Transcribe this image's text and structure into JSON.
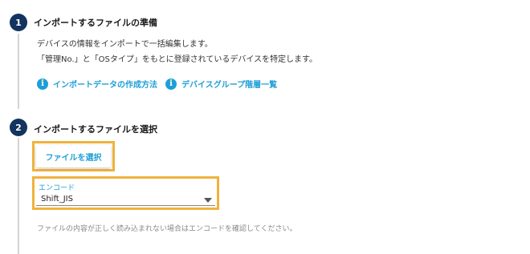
{
  "step1": {
    "number": "1",
    "title": "インポートするファイルの準備",
    "desc_line1": "デバイスの情報をインポートで一括編集します。",
    "desc_line2": "「管理No.」と「OSタイプ」をもとに登録されているデバイスを特定します。",
    "link1_label": "インポートデータの作成方法",
    "link2_label": "デバイスグループ階層一覧",
    "info_glyph": "i"
  },
  "step2": {
    "number": "2",
    "title": "インポートするファイルを選択",
    "file_button_label": "ファイルを選択",
    "encode_label": "エンコード",
    "encode_value": "Shift_JIS",
    "hint": "ファイルの内容が正しく読み込まれない場合はエンコードを確認してください。"
  },
  "colors": {
    "step_circle": "#12345e",
    "accent": "#1e9fd6",
    "highlight": "#f0b23c"
  },
  "icons": {
    "info": "info-circle-icon",
    "dropdown": "caret-down-icon"
  }
}
